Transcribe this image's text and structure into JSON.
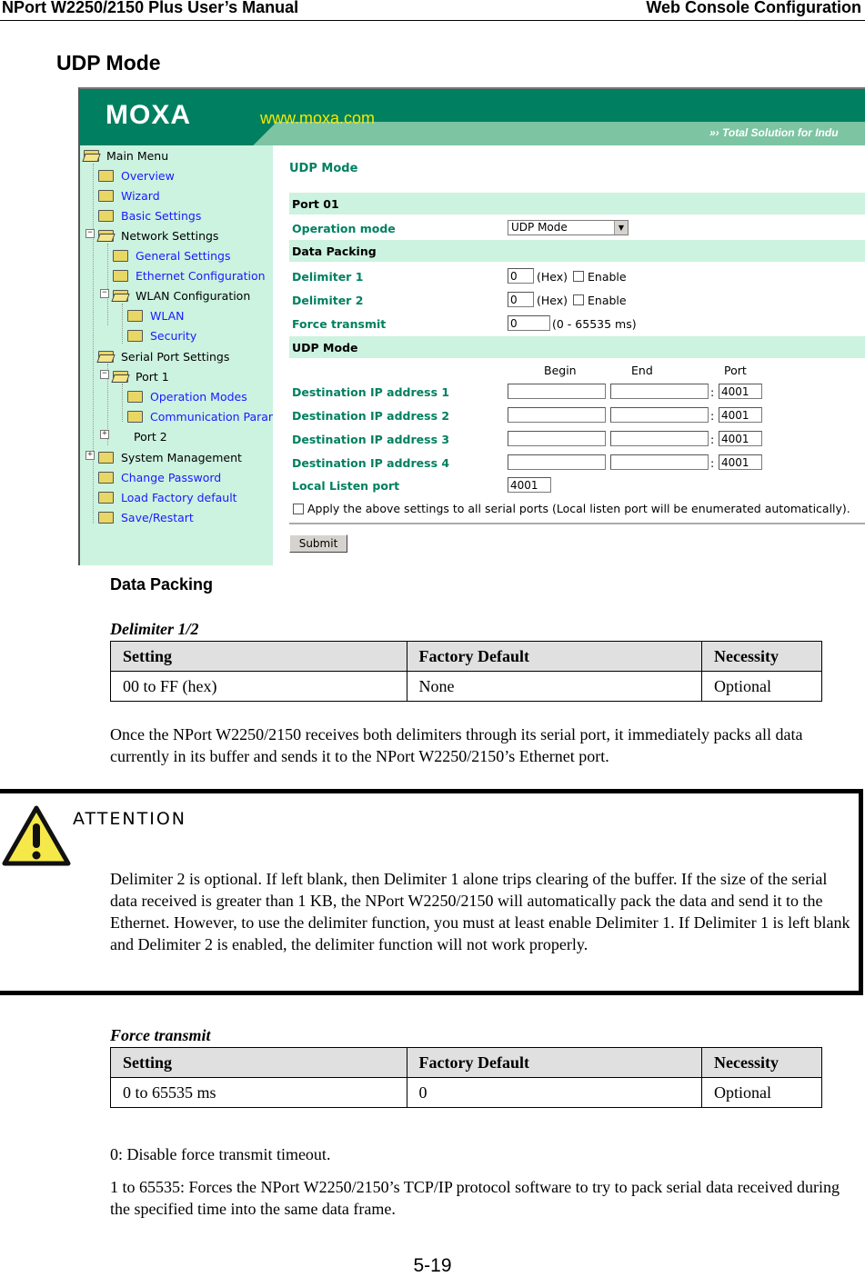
{
  "page_header": {
    "left": "NPort W2250/2150 Plus User’s Manual",
    "right": "Web Console Configuration"
  },
  "section_title": "UDP Mode",
  "screenshot": {
    "banner": {
      "logo": "MOXA",
      "url": "www.moxa.com",
      "tagline": "»› Total Solution for Indu"
    },
    "menu": {
      "root": "Main Menu",
      "items": [
        {
          "label": "Overview",
          "link": true
        },
        {
          "label": "Wizard",
          "link": true
        },
        {
          "label": "Basic Settings",
          "link": true
        },
        {
          "label": "Network Settings",
          "link": false
        },
        {
          "label": "General Settings",
          "link": true
        },
        {
          "label": "Ethernet Configuration",
          "link": true
        },
        {
          "label": "WLAN Configuration",
          "link": false
        },
        {
          "label": "WLAN",
          "link": true
        },
        {
          "label": "Security",
          "link": true
        },
        {
          "label": "Serial Port Settings",
          "link": false
        },
        {
          "label": "Port 1",
          "link": false
        },
        {
          "label": "Operation Modes",
          "link": true
        },
        {
          "label": "Communication Paran",
          "link": true
        },
        {
          "label": "Port 2",
          "link": false
        },
        {
          "label": "System Management",
          "link": false
        },
        {
          "label": "Change Password",
          "link": true
        },
        {
          "label": "Load Factory default",
          "link": true
        },
        {
          "label": "Save/Restart",
          "link": true
        }
      ]
    },
    "form": {
      "title": "UDP Mode",
      "port_band": "Port 01",
      "operation_mode_label": "Operation mode",
      "operation_mode_value": "UDP Mode",
      "data_packing_band": "Data Packing",
      "delimiter1_label": "Delimiter 1",
      "delimiter1_value": "0",
      "delimiter2_label": "Delimiter 2",
      "delimiter2_value": "0",
      "hex_suffix": "(Hex)",
      "enable_label": "Enable",
      "delimiter1_enabled": false,
      "delimiter2_enabled": false,
      "force_transmit_label": "Force transmit",
      "force_transmit_value": "0",
      "force_transmit_range": "(0 - 65535 ms)",
      "udp_band": "UDP Mode",
      "col_begin": "Begin",
      "col_end": "End",
      "col_port": "Port",
      "destinations": [
        {
          "label": "Destination IP address 1",
          "begin": "",
          "end": "",
          "port": "4001"
        },
        {
          "label": "Destination IP address 2",
          "begin": "",
          "end": "",
          "port": "4001"
        },
        {
          "label": "Destination IP address 3",
          "begin": "",
          "end": "",
          "port": "4001"
        },
        {
          "label": "Destination IP address 4",
          "begin": "",
          "end": "",
          "port": "4001"
        }
      ],
      "colon": ":",
      "local_listen_label": "Local Listen port",
      "local_listen_value": "4001",
      "apply_all_label": "Apply the above settings to all serial ports (Local listen port will be enumerated automatically).",
      "apply_all_checked": false,
      "submit_label": "Submit"
    }
  },
  "data_packing_heading": "Data Packing",
  "delimiter_table": {
    "caption": "Delimiter 1/2",
    "headers": [
      "Setting",
      "Factory Default",
      "Necessity"
    ],
    "row": [
      "00 to FF (hex)",
      "None",
      "Optional"
    ]
  },
  "delimiter_paragraph": "Once the NPort W2250/2150 receives both delimiters through its serial port, it immediately packs all data currently in its buffer and sends it to the NPort W2250/2150’s Ethernet port.",
  "attention": {
    "title": "ATTENTION",
    "body": "Delimiter 2 is optional. If left blank, then Delimiter 1 alone trips clearing of the buffer. If the size of the serial data received is greater than 1 KB, the NPort W2250/2150 will automatically pack the data and send it to the Ethernet. However, to use the delimiter function, you must at least enable Delimiter 1. If Delimiter 1 is left blank and Delimiter 2 is enabled, the delimiter function will not work properly."
  },
  "force_table": {
    "caption": "Force transmit",
    "headers": [
      "Setting",
      "Factory Default",
      "Necessity"
    ],
    "row": [
      "0 to 65535 ms",
      "0",
      "Optional"
    ]
  },
  "force_paragraphs": [
    "0: Disable force transmit timeout.",
    "1 to 65535: Forces the NPort W2250/2150’s TCP/IP protocol software to try to pack serial data received during the specified time into the same data frame."
  ],
  "page_number": "5-19",
  "colors": {
    "moxa_green": "#008060",
    "sidebar_bg": "#ccf2e0",
    "link_blue": "#1a1aff",
    "url_yellow": "#f5e800",
    "warning_yellow": "#f5e94a"
  }
}
